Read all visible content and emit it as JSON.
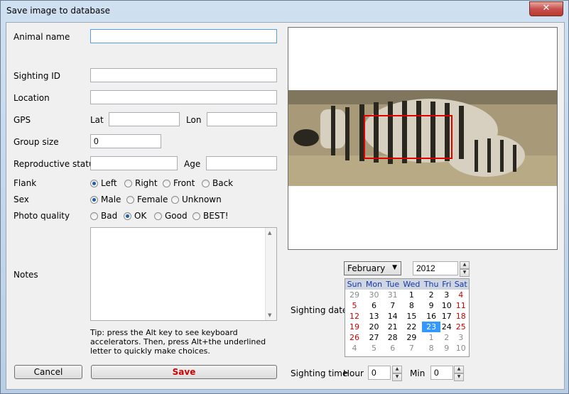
{
  "window": {
    "title": "Save image to database",
    "close_glyph": "✕"
  },
  "form": {
    "animal_name": {
      "label": "Animal name",
      "value": ""
    },
    "sighting_id": {
      "label": "Sighting ID",
      "value": ""
    },
    "location": {
      "label": "Location",
      "value": ""
    },
    "gps": {
      "label": "GPS",
      "lat_label": "Lat",
      "lat_value": "",
      "lon_label": "Lon",
      "lon_value": ""
    },
    "group_size": {
      "label": "Group size",
      "value": "0"
    },
    "reproductive_status": {
      "label": "Reproductive status",
      "value": "",
      "age_label": "Age",
      "age_value": ""
    },
    "flank": {
      "label": "Flank",
      "options": [
        "Left",
        "Right",
        "Front",
        "Back"
      ],
      "selected": "Left"
    },
    "sex": {
      "label": "Sex",
      "options": [
        "Male",
        "Female",
        "Unknown"
      ],
      "selected": "Male"
    },
    "photo_quality": {
      "label": "Photo quality",
      "options": [
        "Bad",
        "OK",
        "Good",
        "BEST!"
      ],
      "selected": "OK"
    },
    "notes": {
      "label": "Notes",
      "value": ""
    },
    "tip": "Tip: press the Alt key to see keyboard accelerators. Then, press Alt+the underlined letter to quickly make choices."
  },
  "buttons": {
    "cancel": "Cancel",
    "save": "Save"
  },
  "sighting_date": {
    "label": "Sighting date",
    "month": "February",
    "year": "2012",
    "weekdays": [
      "Sun",
      "Mon",
      "Tue",
      "Wed",
      "Thu",
      "Fri",
      "Sat"
    ],
    "weeks": [
      [
        "29",
        "30",
        "31",
        "1",
        "2",
        "3",
        "4"
      ],
      [
        "5",
        "6",
        "7",
        "8",
        "9",
        "10",
        "11"
      ],
      [
        "12",
        "13",
        "14",
        "15",
        "16",
        "17",
        "18"
      ],
      [
        "19",
        "20",
        "21",
        "22",
        "23",
        "24",
        "25"
      ],
      [
        "26",
        "27",
        "28",
        "29",
        "1",
        "2",
        "3"
      ],
      [
        "4",
        "5",
        "6",
        "7",
        "8",
        "9",
        "10"
      ]
    ],
    "selected_day": "23"
  },
  "sighting_time": {
    "label": "Sighting time",
    "hour_label": "Hour",
    "hour_value": "0",
    "min_label": "Min",
    "min_value": "0"
  },
  "colors": {
    "accent": "#3399ff",
    "save_text": "#d10000",
    "weekend": "#d10000",
    "selection_box": "#e00000"
  }
}
